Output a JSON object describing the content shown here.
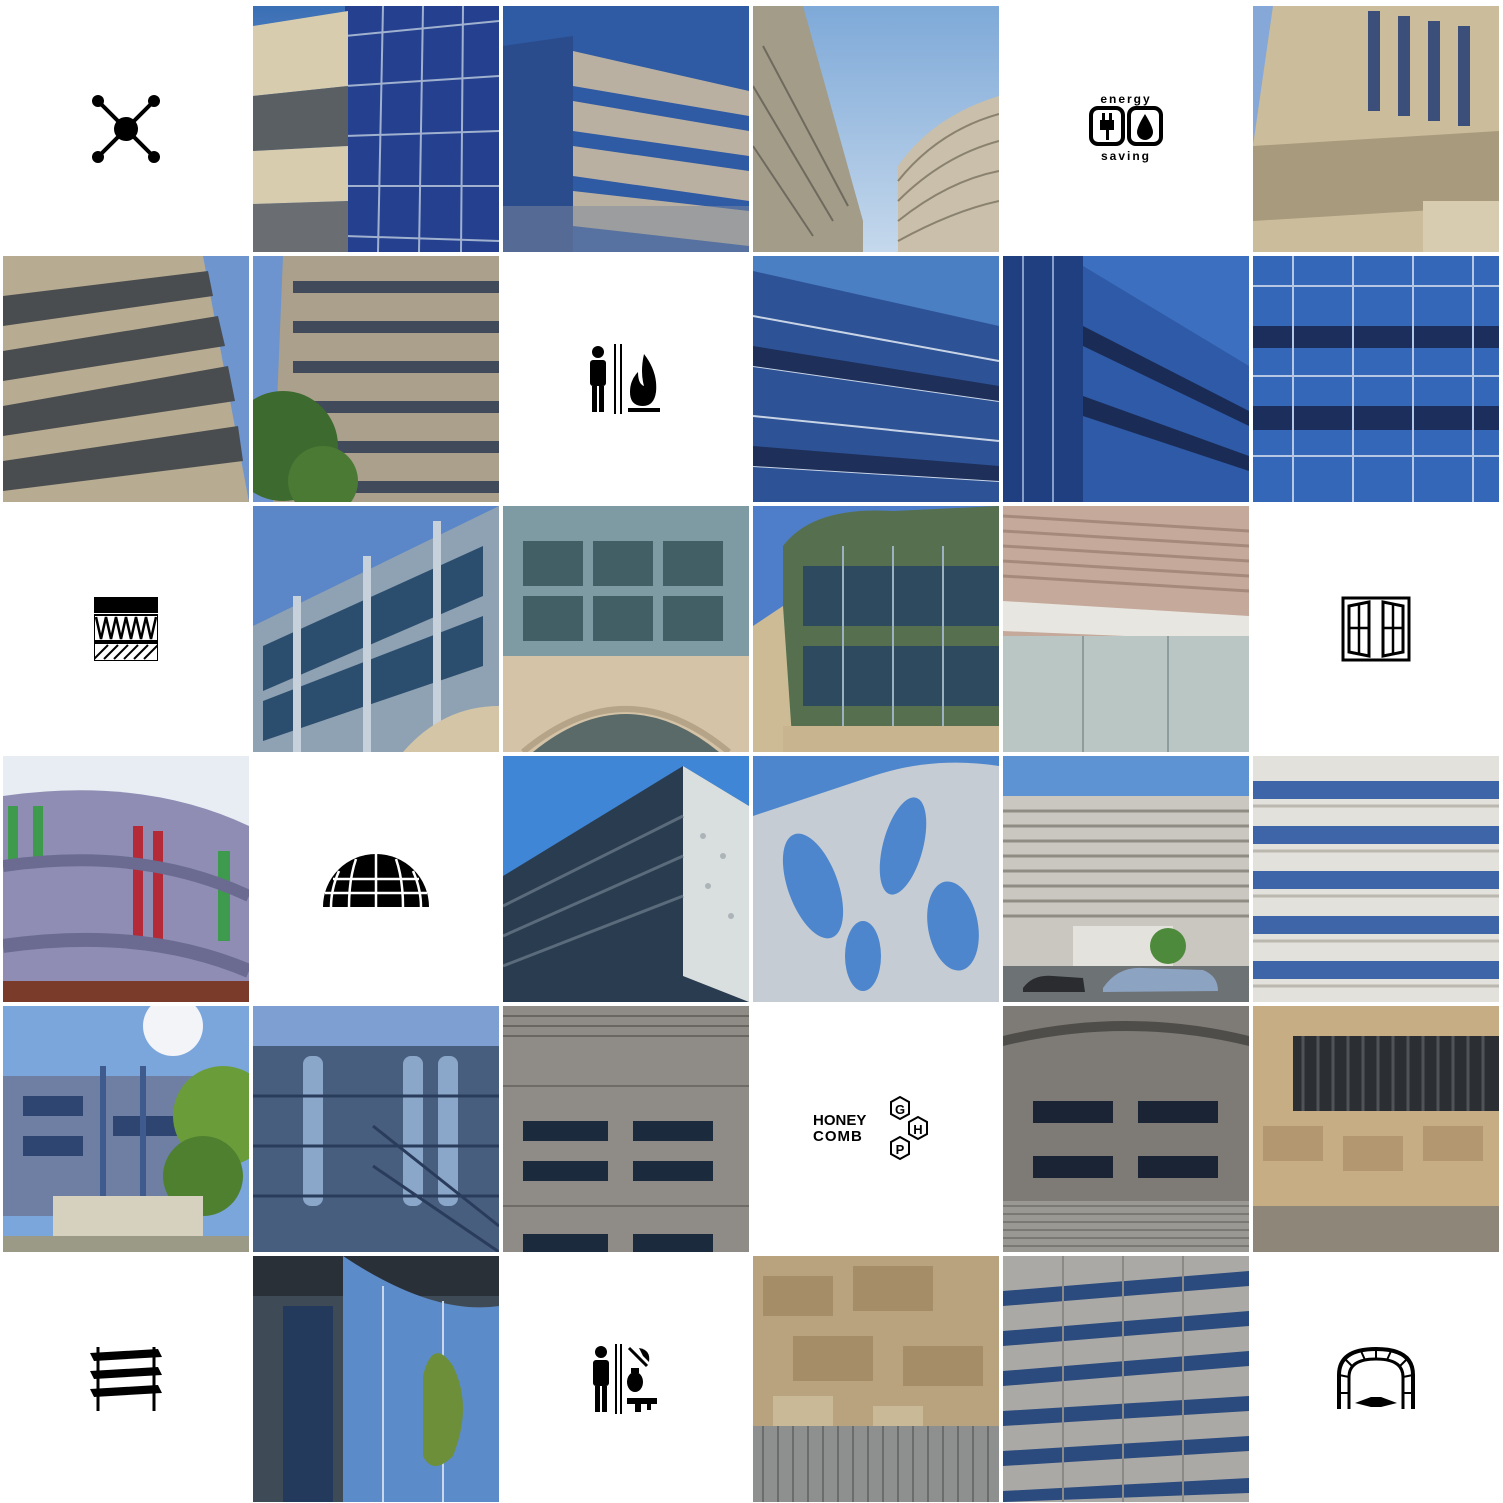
{
  "grid": {
    "tiles": [
      {
        "kind": "icon",
        "name": "network-nodes-icon"
      },
      {
        "kind": "photo",
        "name": "facade-sandstone-blue-glass"
      },
      {
        "kind": "photo",
        "name": "facade-stone-bands-blue-glass"
      },
      {
        "kind": "photo",
        "name": "curved-buildings-courtyard"
      },
      {
        "kind": "icon",
        "name": "energy-saving-icon"
      },
      {
        "kind": "photo",
        "name": "stone-tower-vertical-windows"
      },
      {
        "kind": "photo",
        "name": "stone-bands-angled"
      },
      {
        "kind": "photo",
        "name": "stone-facade-tree"
      },
      {
        "kind": "icon",
        "name": "fire-protection-icon"
      },
      {
        "kind": "photo",
        "name": "blue-glass-curtain-wall-1"
      },
      {
        "kind": "photo",
        "name": "blue-glass-curtain-wall-2"
      },
      {
        "kind": "photo",
        "name": "blue-glass-curtain-wall-3"
      },
      {
        "kind": "icon",
        "name": "thermal-insulation-icon"
      },
      {
        "kind": "photo",
        "name": "glass-facade-columns"
      },
      {
        "kind": "photo",
        "name": "glass-over-stone-arch"
      },
      {
        "kind": "photo",
        "name": "rounded-corner-glass-building"
      },
      {
        "kind": "photo",
        "name": "louvered-facade-glazing"
      },
      {
        "kind": "icon",
        "name": "window-icon"
      },
      {
        "kind": "photo",
        "name": "curved-colored-fins"
      },
      {
        "kind": "icon",
        "name": "dome-structure-icon"
      },
      {
        "kind": "photo",
        "name": "perforated-panel-building"
      },
      {
        "kind": "photo",
        "name": "perforated-organic-facade"
      },
      {
        "kind": "photo",
        "name": "horizontal-louvers-cars"
      },
      {
        "kind": "photo",
        "name": "horizontal-louvers-closeup"
      },
      {
        "kind": "photo",
        "name": "steel-structure-trees"
      },
      {
        "kind": "photo",
        "name": "steel-stairs-blue"
      },
      {
        "kind": "photo",
        "name": "curved-panel-building"
      },
      {
        "kind": "icon",
        "name": "honeycomb-logo-icon"
      },
      {
        "kind": "photo",
        "name": "curved-panel-louvers"
      },
      {
        "kind": "photo",
        "name": "rough-stone-grille"
      },
      {
        "kind": "icon",
        "name": "layered-panels-icon"
      },
      {
        "kind": "photo",
        "name": "curved-glass-reflection"
      },
      {
        "kind": "icon",
        "name": "security-protection-icon"
      },
      {
        "kind": "photo",
        "name": "rough-stone-corrugated"
      },
      {
        "kind": "photo",
        "name": "stone-facade-windows-grid"
      },
      {
        "kind": "icon",
        "name": "tunnel-structure-icon"
      }
    ]
  },
  "energy_icon": {
    "top_text": "energy",
    "bottom_text": "saving"
  },
  "honeycomb_icon": {
    "line1": "HONEY",
    "line2": "COMB",
    "letters": [
      "G",
      "H",
      "P"
    ]
  }
}
